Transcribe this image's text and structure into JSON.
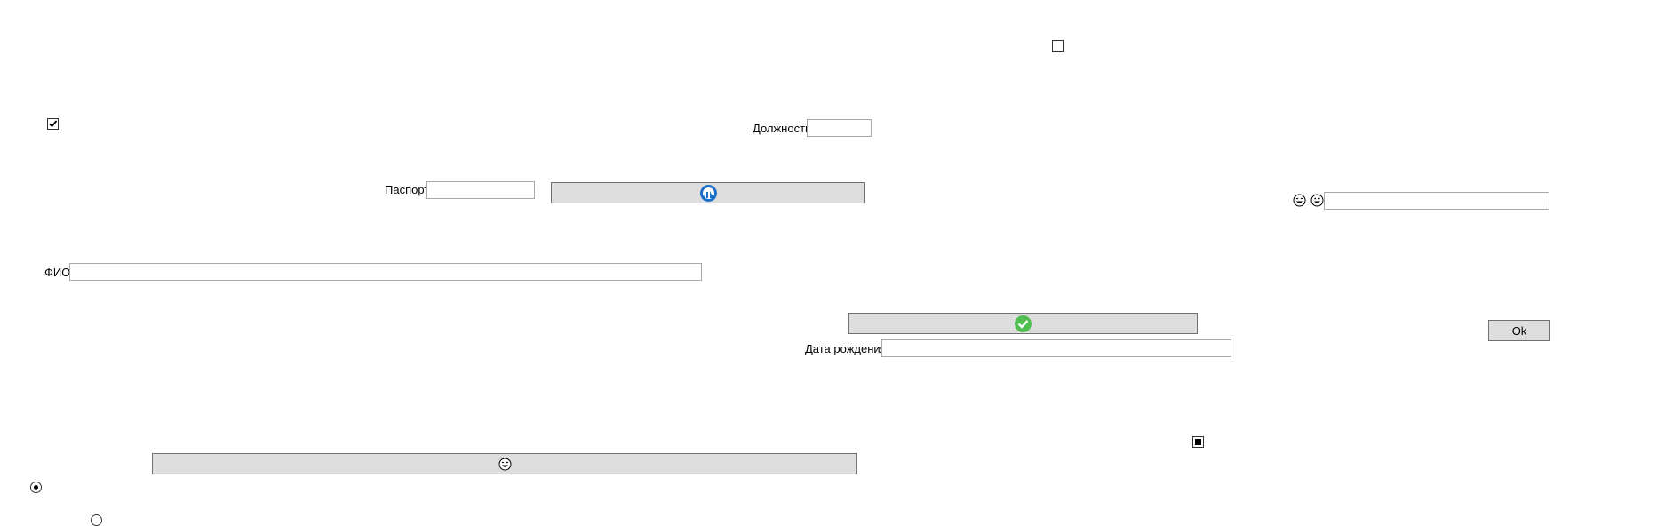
{
  "form": {
    "position_label": "Должность",
    "position_value": "",
    "passport_label": "Паспорт",
    "passport_value": "",
    "fio_label": "ФИО",
    "fio_value": "",
    "birthdate_label": "Дата рождения",
    "birthdate_value": "",
    "emoji_field_value": "",
    "ok_button_label": "Ok"
  },
  "controls": {
    "top_checkbox_checked": false,
    "left_checkbox_checked": true,
    "mid_checkbox_state": "indeterminate",
    "radio_1_selected": true,
    "radio_2_selected": false
  },
  "icons": {
    "blue_button_icon": "refresh-icon",
    "green_button_icon": "check-circle-icon",
    "bottom_button_icon": "laughing-emoji-icon",
    "label_icon_1": "laughing-emoji-icon",
    "label_icon_2": "grinning-emoji-icon"
  },
  "colors": {
    "button_bg": "#dedede",
    "button_border": "#707070",
    "blue_icon": "#1c6fc9",
    "green_icon": "#4fbf4f"
  }
}
